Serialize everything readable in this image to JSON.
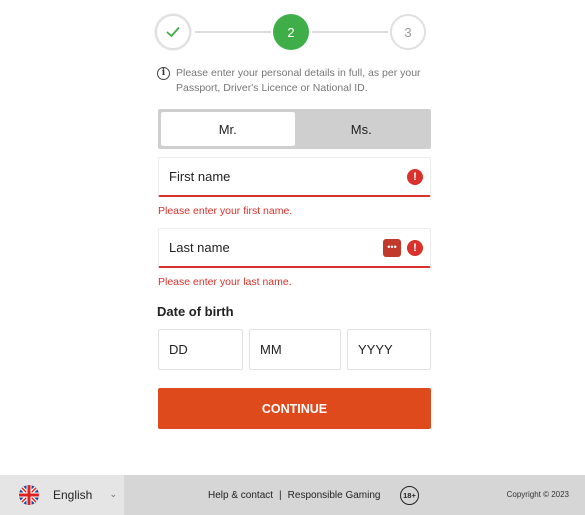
{
  "stepper": {
    "steps": [
      {
        "label": "",
        "state": "done"
      },
      {
        "label": "2",
        "state": "active"
      },
      {
        "label": "3",
        "state": "todo"
      }
    ]
  },
  "info": {
    "text": "Please enter your personal details in full, as per your Passport, Driver's Licence or National ID."
  },
  "title_toggle": {
    "options": [
      "Mr.",
      "Ms."
    ],
    "selected": "Mr."
  },
  "first_name": {
    "placeholder": "First name",
    "error": "Please enter your first name."
  },
  "last_name": {
    "placeholder": "Last name",
    "error": "Please enter your last name."
  },
  "dob": {
    "label": "Date of birth",
    "day_placeholder": "DD",
    "month_placeholder": "MM",
    "year_placeholder": "YYYY"
  },
  "continue_label": "CONTINUE",
  "footer": {
    "language": "English",
    "help_link": "Help & contact",
    "separator": "|",
    "responsible_link": "Responsible Gaming",
    "age_badge": "18+",
    "copyright": "Copyright © 2023"
  },
  "colors": {
    "accent": "#df4a1d",
    "success": "#3fae49",
    "error": "#d9312b"
  }
}
